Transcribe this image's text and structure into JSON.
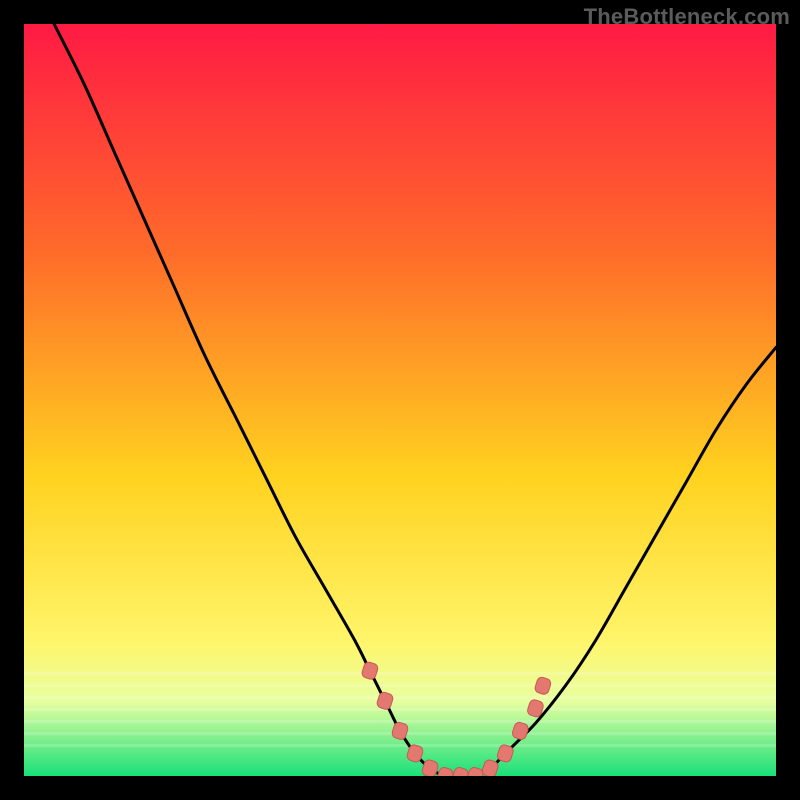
{
  "watermark": "TheBottleneck.com",
  "colors": {
    "gradient_top": "#ff1a44",
    "gradient_mid1": "#ff6a2a",
    "gradient_mid2": "#ffd21f",
    "gradient_mid3": "#fff56a",
    "gradient_bottom_band": "#e8ffa0",
    "gradient_green": "#19e07a",
    "curve": "#000000",
    "marker_fill": "#e2786f",
    "marker_stroke": "#c85a52"
  },
  "chart_data": {
    "type": "line",
    "title": "",
    "xlabel": "",
    "ylabel": "",
    "xlim": [
      0,
      100
    ],
    "ylim": [
      0,
      100
    ],
    "series": [
      {
        "name": "bottleneck-curve",
        "x": [
          4,
          8,
          12,
          16,
          20,
          24,
          28,
          32,
          36,
          40,
          44,
          46,
          48,
          50,
          52,
          54,
          56,
          58,
          60,
          62,
          64,
          68,
          72,
          76,
          80,
          84,
          88,
          92,
          96,
          100
        ],
        "values": [
          100,
          92,
          83,
          74,
          65,
          56,
          48,
          40,
          32,
          25,
          18,
          14,
          10,
          6,
          3,
          1,
          0,
          0,
          0,
          1,
          3,
          7,
          12,
          18,
          25,
          32,
          39,
          46,
          52,
          57
        ]
      }
    ],
    "markers": [
      {
        "x": 46,
        "y": 14
      },
      {
        "x": 48,
        "y": 10
      },
      {
        "x": 50,
        "y": 6
      },
      {
        "x": 52,
        "y": 3
      },
      {
        "x": 54,
        "y": 1
      },
      {
        "x": 56,
        "y": 0
      },
      {
        "x": 58,
        "y": 0
      },
      {
        "x": 60,
        "y": 0
      },
      {
        "x": 62,
        "y": 1
      },
      {
        "x": 64,
        "y": 3
      },
      {
        "x": 66,
        "y": 6
      },
      {
        "x": 68,
        "y": 9
      },
      {
        "x": 69,
        "y": 12
      }
    ],
    "annotations": []
  }
}
